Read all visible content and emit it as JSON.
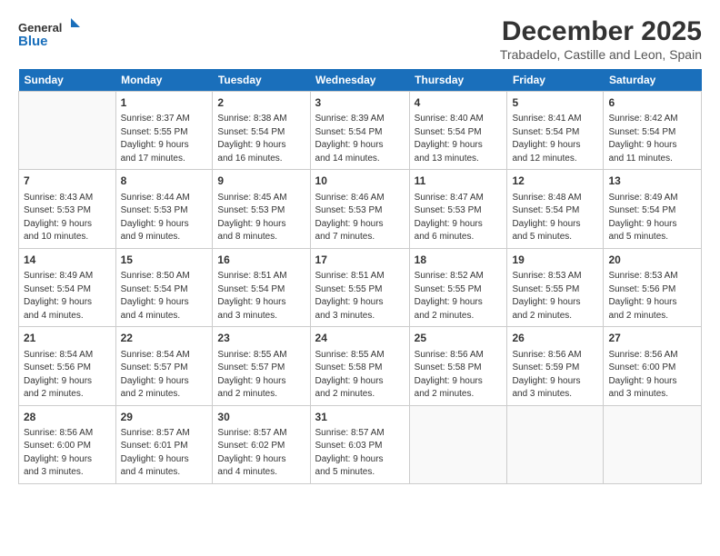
{
  "logo": {
    "line1": "General",
    "line2": "Blue"
  },
  "title": "December 2025",
  "location": "Trabadelo, Castille and Leon, Spain",
  "days_of_week": [
    "Sunday",
    "Monday",
    "Tuesday",
    "Wednesday",
    "Thursday",
    "Friday",
    "Saturday"
  ],
  "weeks": [
    [
      {
        "day": "",
        "info": ""
      },
      {
        "day": "1",
        "info": "Sunrise: 8:37 AM\nSunset: 5:55 PM\nDaylight: 9 hours\nand 17 minutes."
      },
      {
        "day": "2",
        "info": "Sunrise: 8:38 AM\nSunset: 5:54 PM\nDaylight: 9 hours\nand 16 minutes."
      },
      {
        "day": "3",
        "info": "Sunrise: 8:39 AM\nSunset: 5:54 PM\nDaylight: 9 hours\nand 14 minutes."
      },
      {
        "day": "4",
        "info": "Sunrise: 8:40 AM\nSunset: 5:54 PM\nDaylight: 9 hours\nand 13 minutes."
      },
      {
        "day": "5",
        "info": "Sunrise: 8:41 AM\nSunset: 5:54 PM\nDaylight: 9 hours\nand 12 minutes."
      },
      {
        "day": "6",
        "info": "Sunrise: 8:42 AM\nSunset: 5:54 PM\nDaylight: 9 hours\nand 11 minutes."
      }
    ],
    [
      {
        "day": "7",
        "info": "Sunrise: 8:43 AM\nSunset: 5:53 PM\nDaylight: 9 hours\nand 10 minutes."
      },
      {
        "day": "8",
        "info": "Sunrise: 8:44 AM\nSunset: 5:53 PM\nDaylight: 9 hours\nand 9 minutes."
      },
      {
        "day": "9",
        "info": "Sunrise: 8:45 AM\nSunset: 5:53 PM\nDaylight: 9 hours\nand 8 minutes."
      },
      {
        "day": "10",
        "info": "Sunrise: 8:46 AM\nSunset: 5:53 PM\nDaylight: 9 hours\nand 7 minutes."
      },
      {
        "day": "11",
        "info": "Sunrise: 8:47 AM\nSunset: 5:53 PM\nDaylight: 9 hours\nand 6 minutes."
      },
      {
        "day": "12",
        "info": "Sunrise: 8:48 AM\nSunset: 5:54 PM\nDaylight: 9 hours\nand 5 minutes."
      },
      {
        "day": "13",
        "info": "Sunrise: 8:49 AM\nSunset: 5:54 PM\nDaylight: 9 hours\nand 5 minutes."
      }
    ],
    [
      {
        "day": "14",
        "info": "Sunrise: 8:49 AM\nSunset: 5:54 PM\nDaylight: 9 hours\nand 4 minutes."
      },
      {
        "day": "15",
        "info": "Sunrise: 8:50 AM\nSunset: 5:54 PM\nDaylight: 9 hours\nand 4 minutes."
      },
      {
        "day": "16",
        "info": "Sunrise: 8:51 AM\nSunset: 5:54 PM\nDaylight: 9 hours\nand 3 minutes."
      },
      {
        "day": "17",
        "info": "Sunrise: 8:51 AM\nSunset: 5:55 PM\nDaylight: 9 hours\nand 3 minutes."
      },
      {
        "day": "18",
        "info": "Sunrise: 8:52 AM\nSunset: 5:55 PM\nDaylight: 9 hours\nand 2 minutes."
      },
      {
        "day": "19",
        "info": "Sunrise: 8:53 AM\nSunset: 5:55 PM\nDaylight: 9 hours\nand 2 minutes."
      },
      {
        "day": "20",
        "info": "Sunrise: 8:53 AM\nSunset: 5:56 PM\nDaylight: 9 hours\nand 2 minutes."
      }
    ],
    [
      {
        "day": "21",
        "info": "Sunrise: 8:54 AM\nSunset: 5:56 PM\nDaylight: 9 hours\nand 2 minutes."
      },
      {
        "day": "22",
        "info": "Sunrise: 8:54 AM\nSunset: 5:57 PM\nDaylight: 9 hours\nand 2 minutes."
      },
      {
        "day": "23",
        "info": "Sunrise: 8:55 AM\nSunset: 5:57 PM\nDaylight: 9 hours\nand 2 minutes."
      },
      {
        "day": "24",
        "info": "Sunrise: 8:55 AM\nSunset: 5:58 PM\nDaylight: 9 hours\nand 2 minutes."
      },
      {
        "day": "25",
        "info": "Sunrise: 8:56 AM\nSunset: 5:58 PM\nDaylight: 9 hours\nand 2 minutes."
      },
      {
        "day": "26",
        "info": "Sunrise: 8:56 AM\nSunset: 5:59 PM\nDaylight: 9 hours\nand 3 minutes."
      },
      {
        "day": "27",
        "info": "Sunrise: 8:56 AM\nSunset: 6:00 PM\nDaylight: 9 hours\nand 3 minutes."
      }
    ],
    [
      {
        "day": "28",
        "info": "Sunrise: 8:56 AM\nSunset: 6:00 PM\nDaylight: 9 hours\nand 3 minutes."
      },
      {
        "day": "29",
        "info": "Sunrise: 8:57 AM\nSunset: 6:01 PM\nDaylight: 9 hours\nand 4 minutes."
      },
      {
        "day": "30",
        "info": "Sunrise: 8:57 AM\nSunset: 6:02 PM\nDaylight: 9 hours\nand 4 minutes."
      },
      {
        "day": "31",
        "info": "Sunrise: 8:57 AM\nSunset: 6:03 PM\nDaylight: 9 hours\nand 5 minutes."
      },
      {
        "day": "",
        "info": ""
      },
      {
        "day": "",
        "info": ""
      },
      {
        "day": "",
        "info": ""
      }
    ]
  ]
}
